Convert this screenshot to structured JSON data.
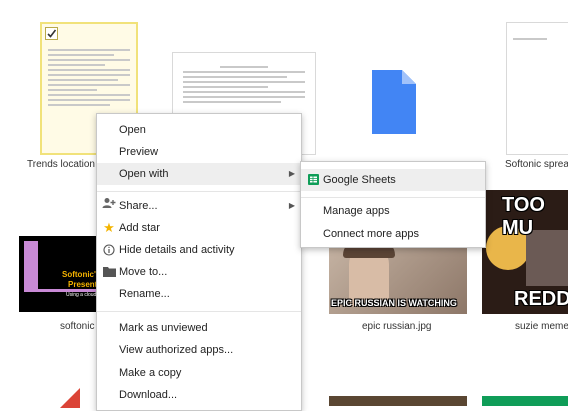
{
  "files": {
    "trends": {
      "name": "Trends location d"
    },
    "softonic_spread": {
      "name": "Softonic spread"
    },
    "softonic": {
      "name": "softonic",
      "slide_title": "Softonic's",
      "slide_subtitle": "Presenta",
      "slide_caption": "Using a cloud a"
    },
    "epic_russian": {
      "name": "epic russian.jpg",
      "overlay": "EPIC RUSSIAN IS WATCHING"
    },
    "suzie": {
      "name": "suzie meme",
      "top": "TOO MU",
      "bottom": "REDD"
    }
  },
  "context_menu": {
    "open": "Open",
    "preview": "Preview",
    "open_with": "Open with",
    "share": "Share...",
    "add_star": "Add star",
    "hide_details": "Hide details and activity",
    "move_to": "Move to...",
    "rename": "Rename...",
    "mark_unviewed": "Mark as unviewed",
    "view_apps": "View authorized apps...",
    "make_copy": "Make a copy",
    "download": "Download..."
  },
  "submenu": {
    "google_sheets": "Google Sheets",
    "manage_apps": "Manage apps",
    "connect_apps": "Connect more apps"
  },
  "colors": {
    "sheets_green": "#0f9d58",
    "doc_blue": "#4285f4",
    "star_yellow": "#f4b400",
    "menu_highlight": "#eeeeee"
  }
}
